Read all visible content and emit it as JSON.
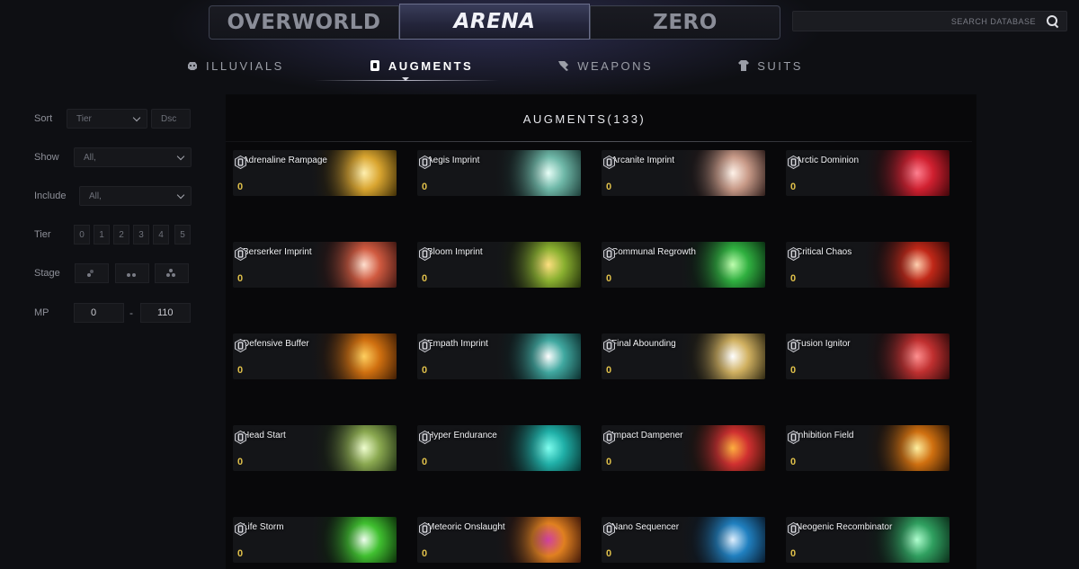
{
  "game_tabs": [
    {
      "label": "OVERWORLD",
      "active": false
    },
    {
      "label": "ARENA",
      "active": true
    },
    {
      "label": "ZERO",
      "active": false
    }
  ],
  "search": {
    "placeholder": "SEARCH DATABASE",
    "icon": "search-icon"
  },
  "categories": [
    {
      "label": "ILLUVIALS",
      "icon": "illuvial-icon",
      "active": false
    },
    {
      "label": "AUGMENTS",
      "icon": "augment-chip-icon",
      "active": true
    },
    {
      "label": "WEAPONS",
      "icon": "weapon-icon",
      "active": false
    },
    {
      "label": "SUITS",
      "icon": "suit-icon",
      "active": false
    }
  ],
  "filters": {
    "sort": {
      "label": "Sort",
      "value": "Tier",
      "direction": "Dsc"
    },
    "show": {
      "label": "Show",
      "value": "All,"
    },
    "include": {
      "label": "Include",
      "value": "All,"
    },
    "tier": {
      "label": "Tier",
      "options": [
        "0",
        "1",
        "2",
        "3",
        "4",
        "5"
      ]
    },
    "stage": {
      "label": "Stage",
      "options": [
        "stage-1-icon",
        "stage-2-icon",
        "stage-3-icon"
      ]
    },
    "mp": {
      "label": "MP",
      "min": "0",
      "separator": "-",
      "max": "110"
    }
  },
  "panel": {
    "title": "AUGMENTS(133)"
  },
  "augments": [
    {
      "name": "Adrenaline Rampage",
      "value": "0",
      "art": [
        "#3a2a05",
        "#d9a530",
        "#fff0b0"
      ]
    },
    {
      "name": "Aegis Imprint",
      "value": "0",
      "art": [
        "#1b3a36",
        "#6fb8a8",
        "#e8fff8"
      ]
    },
    {
      "name": "Arcanite Imprint",
      "value": "0",
      "art": [
        "#2a1a18",
        "#c89a88",
        "#fff3ea"
      ]
    },
    {
      "name": "Arctic Dominion",
      "value": "0",
      "art": [
        "#3a0508",
        "#d02030",
        "#ff8090"
      ]
    },
    {
      "name": "Berserker Imprint",
      "value": "0",
      "art": [
        "#3a1410",
        "#d05a40",
        "#ffe0d0"
      ]
    },
    {
      "name": "Bloom Imprint",
      "value": "0",
      "art": [
        "#1e2a08",
        "#8ab030",
        "#ffe080"
      ]
    },
    {
      "name": "Communal Regrowth",
      "value": "0",
      "art": [
        "#082a10",
        "#30b040",
        "#c0ffb0"
      ]
    },
    {
      "name": "Critical Chaos",
      "value": "0",
      "art": [
        "#2a0606",
        "#c02818",
        "#ffd0b0"
      ]
    },
    {
      "name": "Defensive Buffer",
      "value": "0",
      "art": [
        "#3a1a04",
        "#d07010",
        "#ffd060"
      ]
    },
    {
      "name": "Empath Imprint",
      "value": "0",
      "art": [
        "#0a2a2a",
        "#40a8a0",
        "#ffffff"
      ]
    },
    {
      "name": "Final Abounding",
      "value": "0",
      "art": [
        "#2a2410",
        "#d0b060",
        "#ffffff"
      ]
    },
    {
      "name": "Fusion Ignitor",
      "value": "0",
      "art": [
        "#2a0808",
        "#c03030",
        "#ff9090"
      ]
    },
    {
      "name": "Head Start",
      "value": "0",
      "art": [
        "#1a2a10",
        "#8aa850",
        "#f0ffd0"
      ]
    },
    {
      "name": "Hyper Endurance",
      "value": "0",
      "art": [
        "#05302e",
        "#20b0a8",
        "#80fff0"
      ]
    },
    {
      "name": "Impact Dampener",
      "value": "0",
      "art": [
        "#2a1004",
        "#d03030",
        "#ffb040"
      ]
    },
    {
      "name": "Inhibition Field",
      "value": "0",
      "art": [
        "#2a1404",
        "#d07010",
        "#fff0a0"
      ]
    },
    {
      "name": "Life Storm",
      "value": "0",
      "art": [
        "#0a2a08",
        "#40c030",
        "#f0fff0"
      ]
    },
    {
      "name": "Meteoric Onslaught",
      "value": "0",
      "art": [
        "#3a1408",
        "#e08020",
        "#d040a0"
      ]
    },
    {
      "name": "Nano Sequencer",
      "value": "0",
      "art": [
        "#08182a",
        "#2080c0",
        "#e0f0ff"
      ]
    },
    {
      "name": "Neogenic Recombinator",
      "value": "0",
      "art": [
        "#0a2a18",
        "#30a060",
        "#b0ffd0"
      ]
    }
  ]
}
